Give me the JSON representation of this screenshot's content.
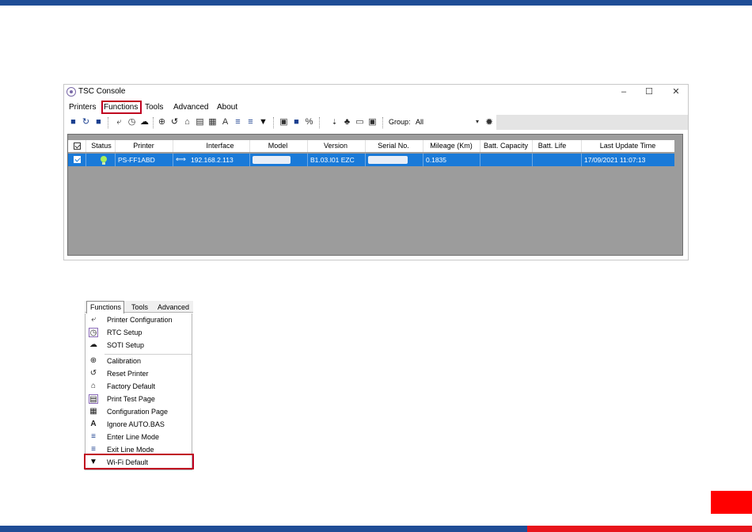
{
  "window": {
    "title": "TSC Console",
    "minimize": "–",
    "maximize": "☐",
    "close": "✕"
  },
  "menubar": [
    "Printers",
    "Functions",
    "Tools",
    "Advanced",
    "About"
  ],
  "toolbar": {
    "group_label": "Group:",
    "group_value": "All"
  },
  "grid": {
    "columns": [
      "Status",
      "Printer",
      "Interface",
      "Model",
      "Version",
      "Serial No.",
      "Mileage (Km)",
      "Batt. Capacity",
      "Batt. Life",
      "Last Update Time"
    ],
    "rows": [
      {
        "printer": "PS-FF1ABD",
        "interface": "192.168.2.113",
        "model": "",
        "version": "B1.03.I01 EZC",
        "serial": "",
        "mileage": "0.1835",
        "batt_capacity": "",
        "batt_life": "",
        "last_update": "17/09/2021 11:07:13"
      }
    ]
  },
  "functions_menu": {
    "tabs": [
      "Functions",
      "Tools",
      "Advanced"
    ],
    "items": [
      "Printer Configuration",
      "RTC Setup",
      "SOTI Setup",
      "Calibration",
      "Reset Printer",
      "Factory Default",
      "Print Test Page",
      "Configuration Page",
      "Ignore AUTO.BAS",
      "Enter Line Mode",
      "Exit Line Mode",
      "Wi-Fi Default"
    ]
  },
  "colors": {
    "brand_blue": "#1f4d96",
    "brand_red": "#e8141b",
    "highlight": "#c00020",
    "selection": "#1a7ad8"
  }
}
